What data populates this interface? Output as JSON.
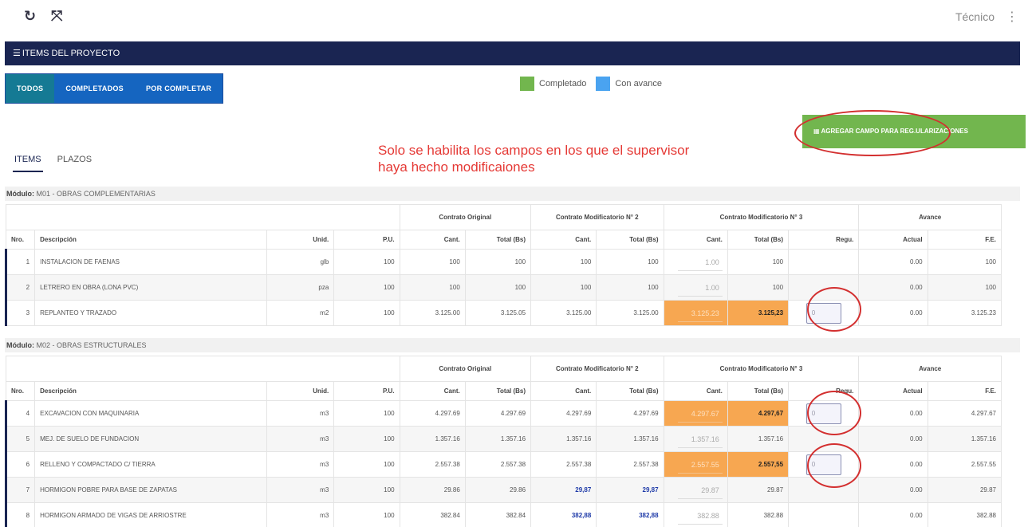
{
  "topbar": {
    "refresh_icon": "↻",
    "expand_icon": "⤧",
    "user": "Técnico",
    "kebab_icon": "⋮"
  },
  "panel": {
    "menu_icon": "☰",
    "title": "ITEMS DEL PROYECTO"
  },
  "filters": {
    "todos": "TODOS",
    "completados": "COMPLETADOS",
    "por_completar": "POR COMPLETAR"
  },
  "legend": [
    {
      "label": "Completado",
      "color": "#72b64e"
    },
    {
      "label": "Con avance",
      "color": "#4aa3f0"
    }
  ],
  "add_button": {
    "icon": "▦",
    "label": "AGREGAR CAMPO PARA REG.ULARIZACIONES"
  },
  "note": {
    "line1": "Solo se habilita los campos en los que el supervisor",
    "line2": "haya hecho modificaiones"
  },
  "tabs": {
    "items": "ITEMS",
    "plazos": "PLAZOS"
  },
  "headers": {
    "contrato_original": "Contrato Original",
    "contrato_mod2": "Contrato Modificatorio N° 2",
    "contrato_mod3": "Contrato Modificatorio N° 3",
    "avance": "Avance",
    "nro": "Nro.",
    "descripcion": "Descripción",
    "unid": "Unid.",
    "pu": "P.U.",
    "cant": "Cant.",
    "total": "Total (Bs)",
    "regu": "Regu.",
    "actual": "Actual",
    "fe": "F.E."
  },
  "modules": [
    {
      "label": "Módulo:",
      "name": "M01 - OBRAS COMPLEMENTARIAS"
    },
    {
      "label": "Módulo:",
      "name": "M02 - OBRAS ESTRUCTURALES"
    }
  ],
  "m01_rows": [
    {
      "nro": "1",
      "desc": "INSTALACION DE FAENAS",
      "unid": "glb",
      "pu": "100",
      "co_cant": "100",
      "co_total": "100",
      "m2_cant": "100",
      "m2_total": "100",
      "m3_cant": "1.00",
      "m3_total": "100",
      "regu": "",
      "actual": "0.00",
      "fe": "100"
    },
    {
      "nro": "2",
      "desc": "LETRERO EN OBRA (LONA PVC)",
      "unid": "pza",
      "pu": "100",
      "co_cant": "100",
      "co_total": "100",
      "m2_cant": "100",
      "m2_total": "100",
      "m3_cant": "1.00",
      "m3_total": "100",
      "regu": "",
      "actual": "0.00",
      "fe": "100"
    },
    {
      "nro": "3",
      "desc": "REPLANTEO Y TRAZADO",
      "unid": "m2",
      "pu": "100",
      "co_cant": "3.125.00",
      "co_total": "3.125.05",
      "m2_cant": "3.125.00",
      "m2_total": "3.125.00",
      "m3_cant": "3.125.23",
      "m3_total": "3.125,23",
      "regu": "0",
      "actual": "0.00",
      "fe": "3.125.23"
    }
  ],
  "m02_rows": [
    {
      "nro": "4",
      "desc": "EXCAVACION CON MAQUINARIA",
      "unid": "m3",
      "pu": "100",
      "co_cant": "4.297.69",
      "co_total": "4.297.69",
      "m2_cant": "4.297.69",
      "m2_total": "4.297.69",
      "m3_cant": "4.297.67",
      "m3_total": "4.297,67",
      "regu": "0",
      "actual": "0.00",
      "fe": "4.297.67"
    },
    {
      "nro": "5",
      "desc": "MEJ. DE SUELO DE FUNDACION",
      "unid": "m3",
      "pu": "100",
      "co_cant": "1.357.16",
      "co_total": "1.357.16",
      "m2_cant": "1.357.16",
      "m2_total": "1.357.16",
      "m3_cant": "1.357.16",
      "m3_total": "1.357.16",
      "regu": "",
      "actual": "0.00",
      "fe": "1.357.16"
    },
    {
      "nro": "6",
      "desc": "RELLENO Y COMPACTADO C/ TIERRA",
      "unid": "m3",
      "pu": "100",
      "co_cant": "2.557.38",
      "co_total": "2.557.38",
      "m2_cant": "2.557.38",
      "m2_total": "2.557.38",
      "m3_cant": "2.557.55",
      "m3_total": "2.557,55",
      "regu": "0",
      "actual": "0.00",
      "fe": "2.557.55"
    },
    {
      "nro": "7",
      "desc": "HORMIGON POBRE PARA BASE DE ZAPATAS",
      "unid": "m3",
      "pu": "100",
      "co_cant": "29.86",
      "co_total": "29.86",
      "m2_cant": "29,87",
      "m2_total": "29,87",
      "m3_cant": "29.87",
      "m3_total": "29.87",
      "regu": "",
      "actual": "0.00",
      "fe": "29.87"
    },
    {
      "nro": "8",
      "desc": "HORMIGON ARMADO DE VIGAS DE ARRIOSTRE",
      "unid": "m3",
      "pu": "100",
      "co_cant": "382.84",
      "co_total": "382.84",
      "m2_cant": "382,88",
      "m2_total": "382,88",
      "m3_cant": "382.88",
      "m3_total": "382.88",
      "regu": "",
      "actual": "0.00",
      "fe": "382.88"
    }
  ]
}
